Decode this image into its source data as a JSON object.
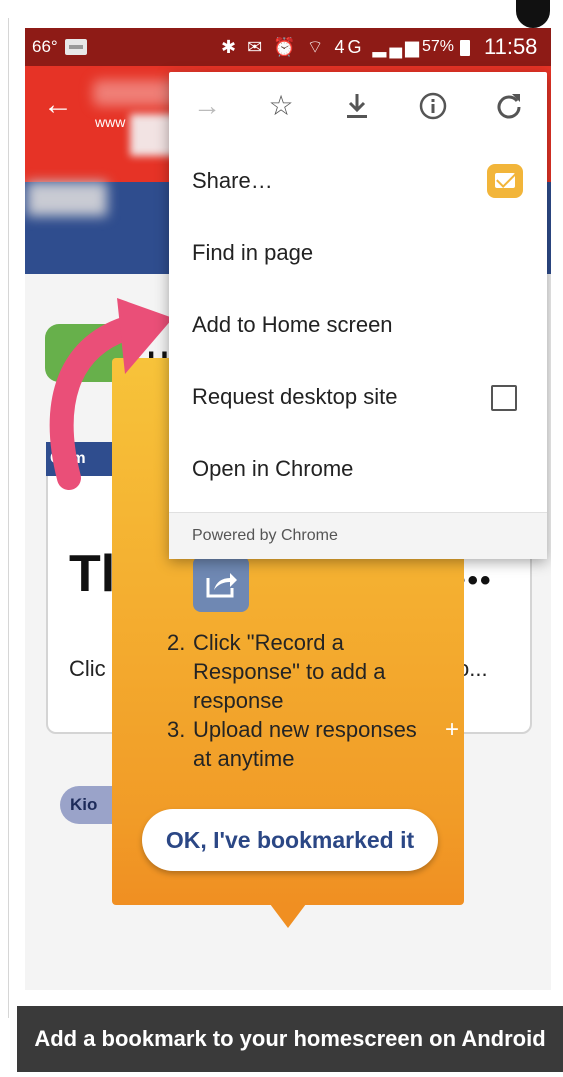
{
  "status_bar": {
    "temperature": "66°",
    "battery": "57%",
    "time": "11:58",
    "icons": "✱ ✉ ⏰ ⌔ 4G ▂▄▆"
  },
  "browser": {
    "url_domain": "www"
  },
  "chrome_menu": {
    "icons": [
      "forward-icon",
      "star-icon",
      "download-icon",
      "info-icon",
      "refresh-icon"
    ],
    "items": [
      "Share…",
      "Find in page",
      "Add to Home screen",
      "Request desktop site",
      "Open in Chrome"
    ],
    "footer": "Powered by Chrome"
  },
  "page": {
    "title_line1": "H",
    "title_line2": "o",
    "card_tag": "Com",
    "card_title": "Tl",
    "card_dots": "•••",
    "card_text": "Clic",
    "card_text_end": "o...",
    "kiosk_tag": "Kio"
  },
  "tooltip": {
    "steps": [
      {
        "num": "2.",
        "lines": [
          "Click \"Record a",
          "Response\" to add a",
          "response"
        ]
      },
      {
        "num": "3.",
        "lines": [
          "Upload new responses",
          "at anytime"
        ]
      }
    ],
    "button": "OK, I've bookmarked it"
  },
  "caption": "Add a bookmark to your homescreen on Android",
  "colors": {
    "toolbar": "#e63326",
    "status_bar": "#8e1b16",
    "hero": "#2f4d8e",
    "tooltip": "#f5b332",
    "arrow": "#ea4f78"
  }
}
